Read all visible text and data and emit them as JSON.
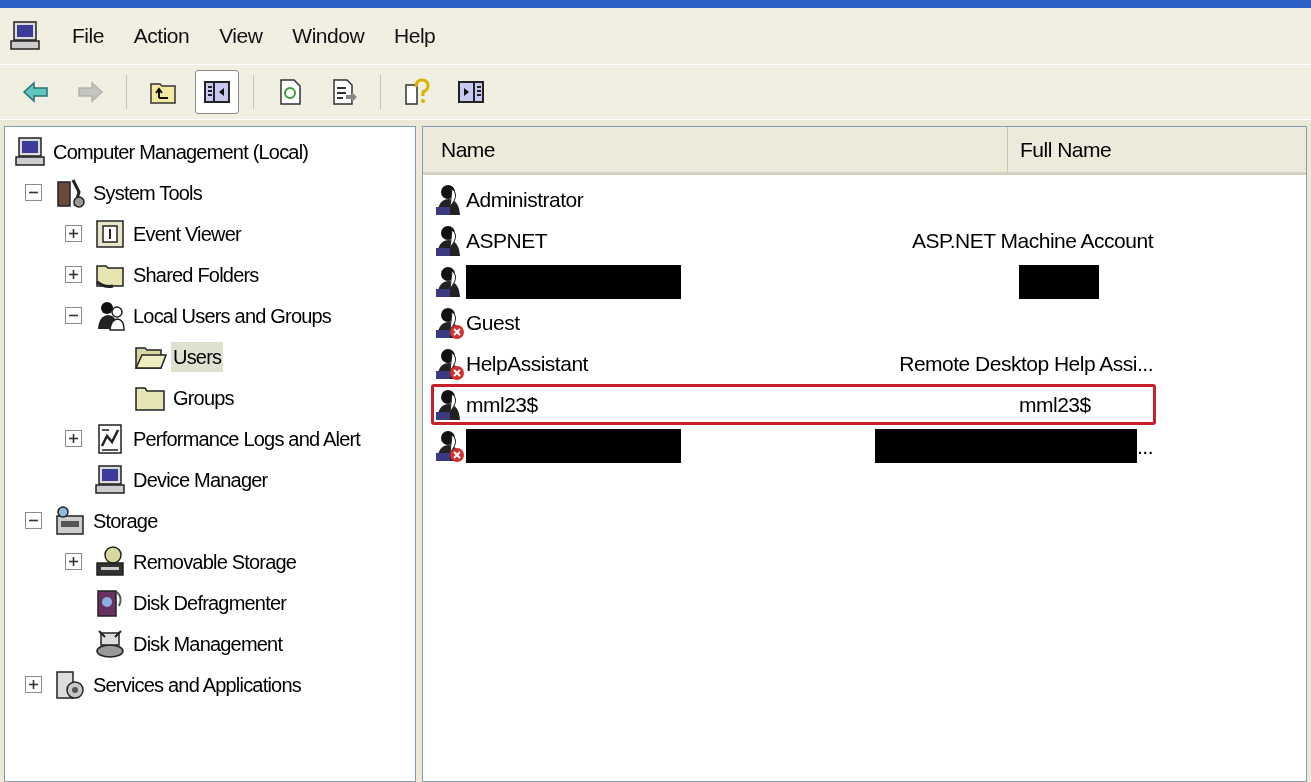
{
  "menu": [
    "File",
    "Action",
    "View",
    "Window",
    "Help"
  ],
  "toolbar": [
    {
      "kind": "back",
      "disabled": false,
      "pressed": false
    },
    {
      "kind": "forward",
      "disabled": true,
      "pressed": false
    },
    {
      "kind": "separator"
    },
    {
      "kind": "up",
      "disabled": false,
      "pressed": false
    },
    {
      "kind": "tree",
      "disabled": false,
      "pressed": true
    },
    {
      "kind": "separator"
    },
    {
      "kind": "refresh",
      "disabled": false,
      "pressed": false
    },
    {
      "kind": "export",
      "disabled": false,
      "pressed": false
    },
    {
      "kind": "separator"
    },
    {
      "kind": "help",
      "disabled": false,
      "pressed": false
    },
    {
      "kind": "pane",
      "disabled": false,
      "pressed": false
    }
  ],
  "tree": [
    {
      "label": "Computer Management (Local)",
      "kind": "computer",
      "selected": false,
      "children": [
        {
          "label": "System Tools",
          "kind": "tools",
          "expanded": true,
          "selected": false,
          "children": [
            {
              "label": "Event Viewer",
              "kind": "event",
              "expanded": false,
              "selected": false
            },
            {
              "label": "Shared Folders",
              "kind": "share",
              "expanded": false,
              "selected": false
            },
            {
              "label": "Local Users and Groups",
              "kind": "users",
              "expanded": true,
              "selected": false,
              "children": [
                {
                  "label": "Users",
                  "kind": "folder-open",
                  "selected": true
                },
                {
                  "label": "Groups",
                  "kind": "folder",
                  "selected": false
                }
              ]
            },
            {
              "label": "Performance Logs and Alert",
              "kind": "perf",
              "expanded": false,
              "selected": false
            },
            {
              "label": "Device Manager",
              "kind": "device",
              "selected": false
            }
          ]
        },
        {
          "label": "Storage",
          "kind": "storage",
          "expanded": true,
          "selected": false,
          "children": [
            {
              "label": "Removable Storage",
              "kind": "removable",
              "expanded": false,
              "selected": false
            },
            {
              "label": "Disk Defragmenter",
              "kind": "defrag",
              "selected": false
            },
            {
              "label": "Disk Management",
              "kind": "diskmgmt",
              "selected": false
            }
          ]
        },
        {
          "label": "Services and Applications",
          "kind": "services",
          "expanded": false,
          "selected": false
        }
      ]
    }
  ],
  "table": {
    "columns": [
      "Name",
      "Full Name"
    ],
    "rows": [
      {
        "name": "Administrator",
        "disabled": false,
        "highlighted": false
      },
      {
        "name": "ASPNET",
        "full_name": "ASP.NET Machine Account",
        "disabled": false,
        "highlighted": false
      },
      {
        "name_redacted": true,
        "full_name_redacted": true,
        "disabled": false,
        "highlighted": false
      },
      {
        "name": "Guest",
        "disabled": true,
        "highlighted": false
      },
      {
        "name": "HelpAssistant",
        "full_name": "Remote Desktop Help Assi...",
        "disabled": true,
        "highlighted": false
      },
      {
        "name": "mml23$",
        "full_name": "mml23$",
        "disabled": false,
        "highlighted": true
      },
      {
        "name_redacted": true,
        "full_name_redacted": true,
        "full_name": "...",
        "disabled": true,
        "highlighted": false
      }
    ]
  }
}
